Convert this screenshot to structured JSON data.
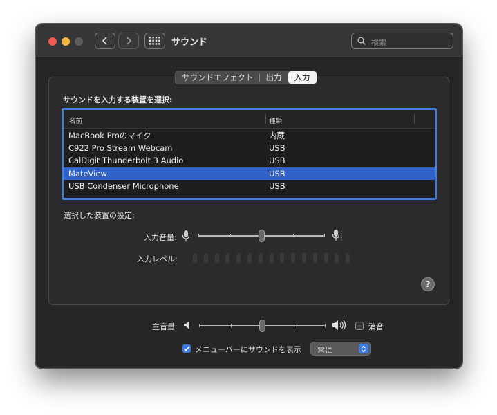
{
  "window": {
    "title": "サウンド",
    "search": {
      "placeholder": "検索"
    }
  },
  "tabs": [
    {
      "label": "サウンドエフェクト",
      "active": false
    },
    {
      "label": "出力",
      "active": false
    },
    {
      "label": "入力",
      "active": true
    }
  ],
  "input_section": {
    "device_prompt": "サウンドを入力する装置を選択:",
    "columns": [
      "名前",
      "種類"
    ],
    "devices": [
      {
        "name": "MacBook Proのマイク",
        "type": "内蔵",
        "selected": false
      },
      {
        "name": "C922 Pro Stream Webcam",
        "type": "USB",
        "selected": false
      },
      {
        "name": "CalDigit Thunderbolt 3 Audio",
        "type": "USB",
        "selected": false
      },
      {
        "name": "MateView",
        "type": "USB",
        "selected": true
      },
      {
        "name": "USB Condenser Microphone",
        "type": "USB",
        "selected": false
      }
    ],
    "settings_label": "選択した装置の設定:",
    "input_volume_label": "入力音量:",
    "input_volume": 0.5,
    "input_level_label": "入力レベル:",
    "input_level_segments": 15,
    "input_level_active": 0
  },
  "output_volume": {
    "label": "主音量:",
    "value": 0.5,
    "mute_label": "消音",
    "muted": false
  },
  "menubar": {
    "label": "メニューバーにサウンドを表示",
    "checked": true,
    "selected_option": "常に"
  },
  "help_glyph": "?",
  "colors": {
    "window_bg": "#262627",
    "accent": "#3f7ee6",
    "selection": "#2f62c9",
    "close": "#ee5b51",
    "minimize": "#f2b83d"
  }
}
